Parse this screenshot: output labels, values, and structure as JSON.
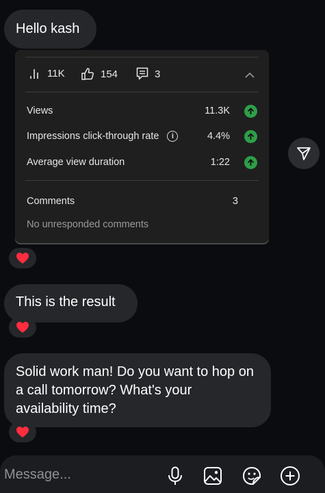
{
  "messages": [
    {
      "text": "Hello kash"
    },
    {
      "text": "This is the result"
    },
    {
      "text": "Solid work man! Do you want to hop on a call tomorrow? What's your availability time?"
    }
  ],
  "analytics": {
    "stats": {
      "views": "11K",
      "likes": "154",
      "comments": "3"
    },
    "rows": [
      {
        "label": "Views",
        "value": "11.3K"
      },
      {
        "label": "Impressions click-through rate",
        "value": "4.4%"
      },
      {
        "label": "Average view duration",
        "value": "1:22"
      }
    ],
    "comments_label": "Comments",
    "comments_count": "3",
    "no_unresponded": "No unresponded comments",
    "trend_color": "#2e9e48"
  },
  "reactions": [
    "heart",
    "heart",
    "heart"
  ],
  "composer": {
    "placeholder": "Message..."
  },
  "icons": [
    "bar-chart-icon",
    "thumbs-up-icon",
    "comment-icon",
    "chevron-up-icon",
    "info-icon",
    "arrow-up-icon",
    "send-icon",
    "microphone-icon",
    "image-icon",
    "sticker-icon",
    "plus-circle-icon",
    "heart-icon"
  ]
}
